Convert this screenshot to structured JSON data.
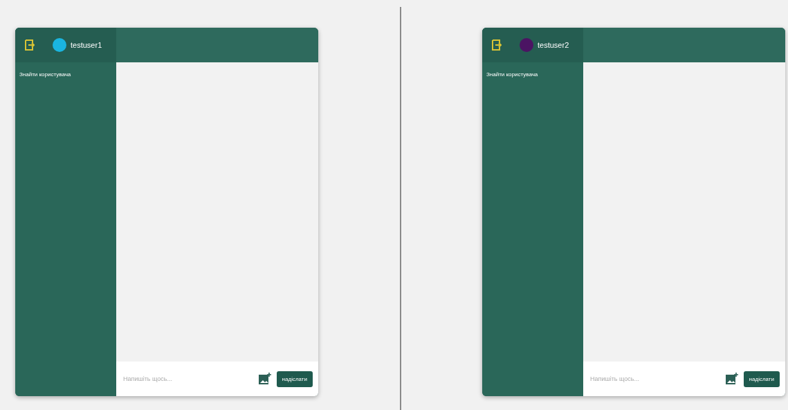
{
  "chats": [
    {
      "user": {
        "name": "testuser1",
        "color": "#1ab5e0"
      },
      "search": {
        "placeholder": "Знайти користувача"
      },
      "composer": {
        "placeholder": "Напишіть щось...",
        "send_label": "надіслати"
      }
    },
    {
      "user": {
        "name": "testuser2",
        "color": "#4b1463"
      },
      "search": {
        "placeholder": "Знайти користувача"
      },
      "composer": {
        "placeholder": "Напишіть щось...",
        "send_label": "надіслати"
      }
    }
  ]
}
